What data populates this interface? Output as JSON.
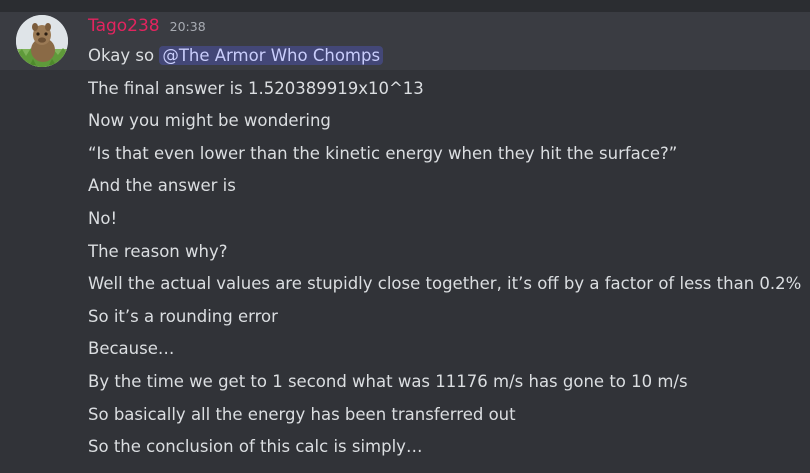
{
  "colors": {
    "background": "#313338",
    "highlight": "#3a3c42",
    "username": "#e2245f",
    "mention_bg": "#4a4f7a",
    "text": "#dbdee1",
    "timestamp": "#a8acb3"
  },
  "message": {
    "author": "Tago238",
    "timestamp": "20:38",
    "avatar_icon": "capybara-avatar-icon",
    "first_line": {
      "prefix": "Okay so ",
      "mention": "@The Armor Who Chomps"
    },
    "lines": [
      "The final answer is 1.520389919x10^13",
      "Now you might be wondering",
      "“Is that even lower than the kinetic energy when they hit the surface?”",
      "And the answer is",
      "No!",
      "The reason why?",
      "Well the actual values are stupidly close together, it’s off by a factor of less than 0.2%",
      "So it’s a rounding error",
      "Because…",
      "By the time we get to 1 second what was 11176 m/s has gone to 10 m/s",
      "So basically all the energy has been transferred out",
      "So the conclusion of this calc is simply…"
    ]
  }
}
